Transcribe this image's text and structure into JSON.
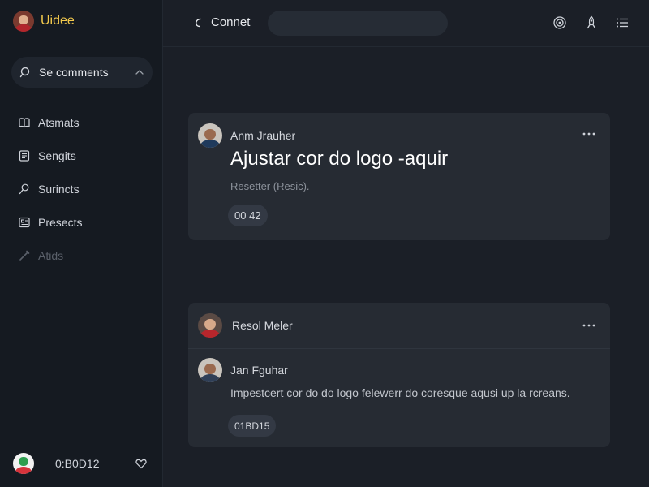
{
  "app": {
    "brand": "Uidee"
  },
  "sidebar": {
    "search": {
      "label": "Se comments",
      "icon": "search-icon"
    },
    "items": [
      {
        "label": "Atsmats",
        "icon": "book-icon",
        "muted": false
      },
      {
        "label": "Sengits",
        "icon": "notes-icon",
        "muted": false
      },
      {
        "label": "Surincts",
        "icon": "pin-icon",
        "muted": false
      },
      {
        "label": "Presects",
        "icon": "folder-icon",
        "muted": false
      },
      {
        "label": "Atids",
        "icon": "edit-icon",
        "muted": true
      }
    ],
    "footer": {
      "code": "0:B0D12",
      "icon": "heart-icon"
    }
  },
  "header": {
    "back_label": "Connet",
    "icons": [
      "target-icon",
      "rocket-icon",
      "menu-list-icon"
    ]
  },
  "cards": [
    {
      "author": "Anm Jrauher",
      "title": "Ajustar cor do logo -aquir",
      "subtitle": "Resetter (Resic).",
      "chip": "00 42"
    },
    {
      "author": "Resol Meler",
      "reply": {
        "author": "Jan Fguhar",
        "text": "Impestcert cor do do logo felewerr do coresque aqusi up la rcreans.",
        "chip": "01BD15"
      }
    }
  ],
  "colors": {
    "background": "#1b1f27",
    "sidebar": "#151a21",
    "card": "#262b33",
    "brand_accent": "#f2c94c"
  }
}
